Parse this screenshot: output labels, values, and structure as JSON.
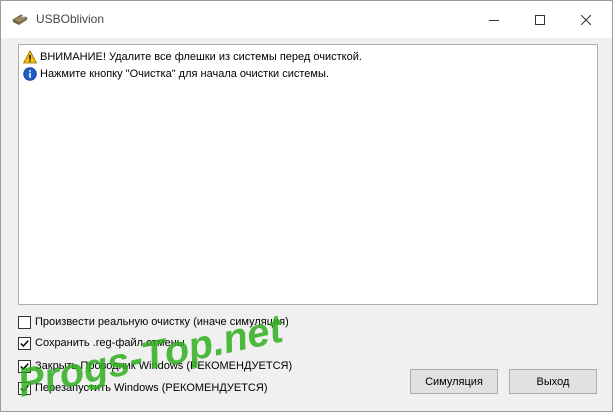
{
  "window": {
    "title": "USBOblivion"
  },
  "log": [
    {
      "icon": "warning-icon",
      "text": "ВНИМАНИЕ! Удалите все флешки из системы перед очисткой."
    },
    {
      "icon": "info-icon",
      "text": "Нажмите кнопку \"Очистка\" для начала очистки системы."
    }
  ],
  "options": [
    {
      "label": "Произвести реальную очистку (иначе симуляция)",
      "checked": false
    },
    {
      "label": "Сохранить .reg-файл отмены",
      "checked": true
    },
    {
      "label": "Закрыть Проводник Windows (РЕКОМЕНДУЕТСЯ)",
      "checked": true
    },
    {
      "label": "Перезапустить Windows (РЕКОМЕНДУЕТСЯ)",
      "checked": true
    }
  ],
  "buttons": {
    "simulate": "Симуляция",
    "exit": "Выход"
  },
  "watermark": {
    "text": "Progs-Top.net"
  },
  "colors": {
    "watermark": "#2fae1f",
    "warning": "#f5c000",
    "info": "#1e5cc8"
  }
}
